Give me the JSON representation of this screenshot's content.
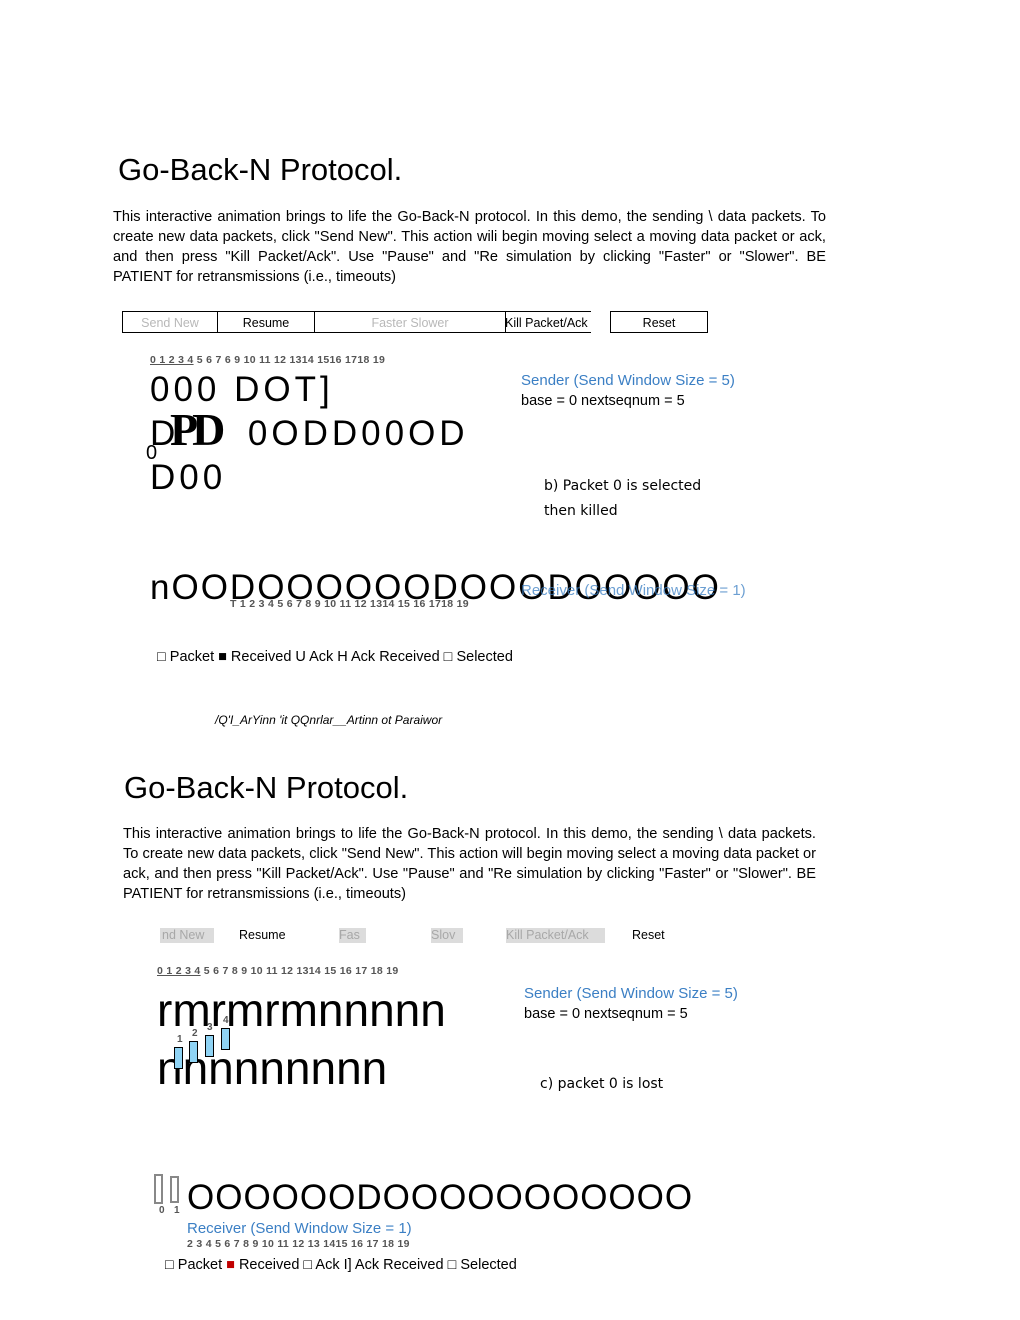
{
  "section1": {
    "title": "Go-Back-N Protocol.",
    "paragraph": "This interactive animation brings to life the Go-Back-N protocol. In this demo, the sending \\ data packets. To create new data packets, click \"Send New\". This action wili begin moving select a moving data packet or ack, and then press \"Kill Packet/Ack\". Use \"Pause\" and \"Re simulation by clicking \"Faster\" or \"Slower\". BE PATIENT for retransmissions (i.e., timeouts)",
    "buttons": {
      "send_new": "Send New",
      "resume": "Resume",
      "faster_slower": "Faster Slower",
      "kill": "Kill Packet/Ack",
      "reset": "Reset"
    },
    "seq_underlined": "0 1 2 3 4",
    "seq_rest": " 5 6 7 6 9 10 11 12 1314 1516 1718 19",
    "sender_row1": "000 DOT]",
    "sender_row2": "D     0ODD00OD",
    "sender_row3": "D00",
    "overlay_glyph": "PD",
    "overlay_zero": "0",
    "sender_label": "Sender (Send Window Size = 5)",
    "sender_state": "base = 0 nextseqnum = 5",
    "caption_line1": "b)  Packet  0  is  selected",
    "caption_line2": "then killed",
    "receiver_row": "nOODOOOOOODOOODOOOOO",
    "receiver_label": "Receiver (Send Window Size = 1)",
    "receiver_seq": "T 1 2 3 4 5 6 7 8 9 10 11 12 1314 15 16 1718 19",
    "legend": "□ Packet ■ Received U Ack H Ack Received □ Selected",
    "garbled": "/Q'I_ArYinn 'it QQnrlar__Artinn ot Paraiwor"
  },
  "section2": {
    "title": "Go-Back-N Protocol.",
    "paragraph": "This interactive animation brings to life the Go-Back-N protocol. In this demo, the sending \\ data packets. To create new data packets, click \"Send New\". This action will begin moving select a moving data packet or ack, and then press \"Kill Packet/Ack\". Use \"Pause\" and \"Re simulation by clicking \"Faster\" or \"Slower\". BE PATIENT for retransmissions (i.e., timeouts)",
    "buttons": {
      "send_new": "nd New",
      "resume": "Resume",
      "faster": "Fas",
      "slower": "Slov",
      "kill": "Kill Packet/Ack",
      "reset": "Reset"
    },
    "seq_underlined": "0 1 2 3 4",
    "seq_rest": " 5 6 7 8 9 10 11 12 1314 15 16 17 18 19",
    "sender_row1": "rmrmrmnnnnn",
    "sender_row2": "nnnnnnnnn",
    "packet_numbers": [
      "1",
      "2",
      "3",
      "4"
    ],
    "sender_label": "Sender (Send Window Size = 5)",
    "sender_state": "base = 0 nextseqnum = 5",
    "caption": "c) packet 0 is lost",
    "receiver_row": "OOOOOODOOOOOOOOOOO",
    "receiver_numbers": [
      "0",
      "1"
    ],
    "receiver_label": "Receiver (Send Window Size = 1)",
    "receiver_seq": "2 3 4 5 6 7 8 9 10 11 12 13 1415 16 17 18 19",
    "legend_a": "□ Packet ",
    "legend_red": "■",
    "legend_b": " Received □ Ack I] Ack Received □ Selected"
  }
}
